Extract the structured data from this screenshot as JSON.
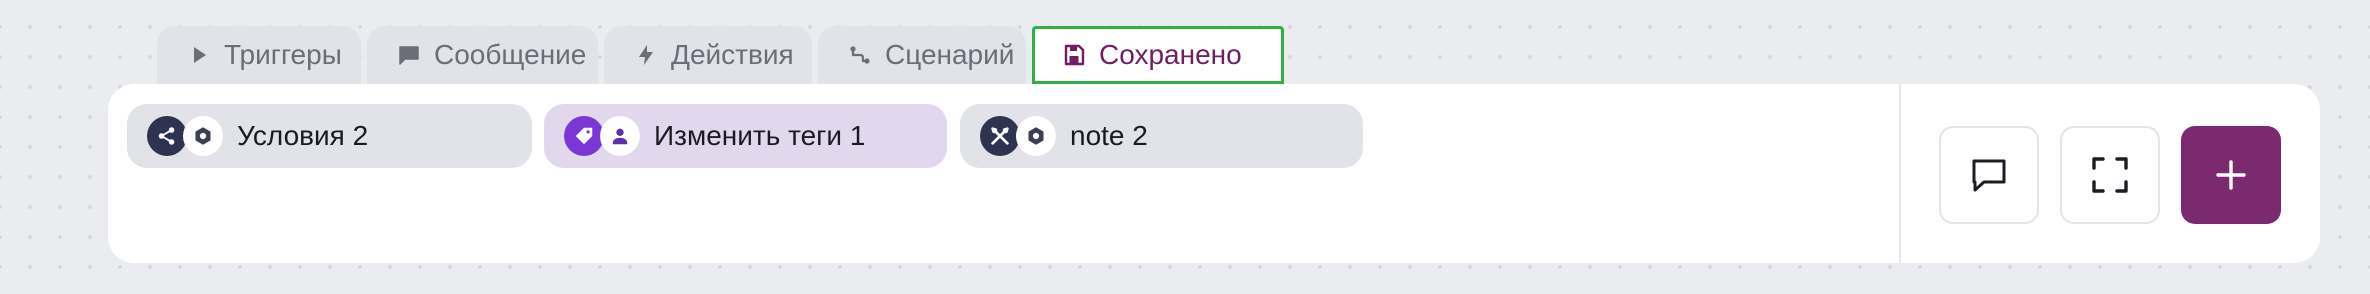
{
  "tabs": [
    {
      "label": "Триггеры",
      "icon": "play-icon"
    },
    {
      "label": "Сообщение",
      "icon": "chat-icon"
    },
    {
      "label": "Действия",
      "icon": "bolt-icon"
    },
    {
      "label": "Сценарий",
      "icon": "flow-icon"
    },
    {
      "label": "Сохранено",
      "icon": "save-icon",
      "active": true
    }
  ],
  "nodes": [
    {
      "label": "Условия 2",
      "icons": [
        "share-icon",
        "hexagon-icon"
      ]
    },
    {
      "label": "Изменить теги 1",
      "icons": [
        "tag-icon",
        "user-icon"
      ]
    },
    {
      "label": "note 2",
      "icons": [
        "tools-icon",
        "hexagon-icon"
      ]
    }
  ],
  "toolbar": {
    "buttons": [
      "comment-icon",
      "fullscreen-icon",
      "plus-icon"
    ]
  },
  "colors": {
    "accent": "#7b2a70",
    "active_tab_text": "#6e1f66",
    "active_tab_border": "#2fb047",
    "node_purple": "#7b37d6",
    "node_dark": "#2d3350"
  }
}
